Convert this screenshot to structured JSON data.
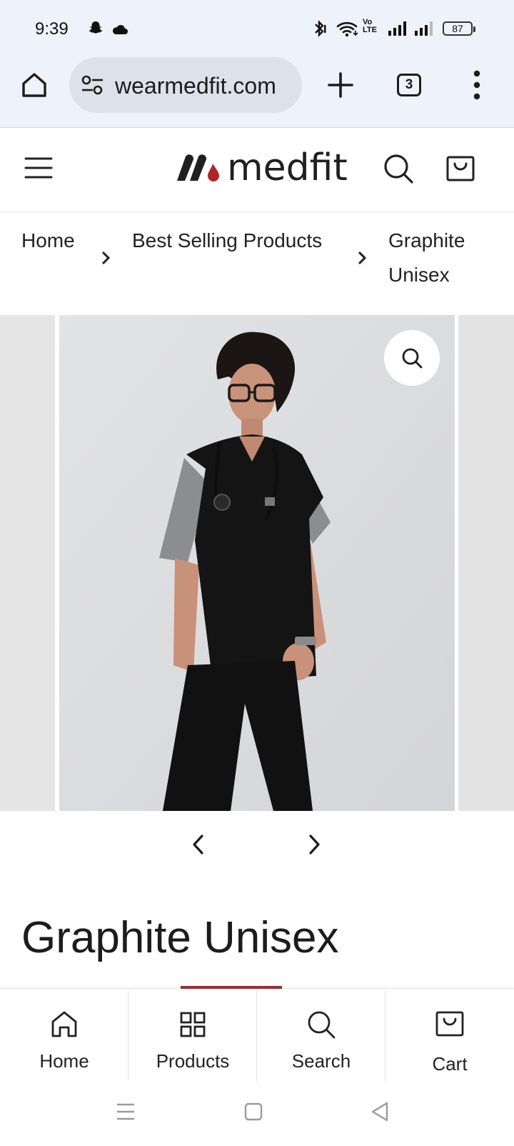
{
  "status_bar": {
    "time": "9:39",
    "volte_top": "Vo",
    "volte_bottom": "LTE",
    "battery": "87"
  },
  "browser": {
    "url": "wearmedfit.com",
    "tab_count": "3"
  },
  "site": {
    "logo_text": "medfit",
    "brand_colors": {
      "dark": "#1f1f1f",
      "accent": "#b0222c"
    }
  },
  "breadcrumb": {
    "items": [
      "Home",
      "Best Selling Products",
      "Graphite",
      "Unisex"
    ]
  },
  "product": {
    "title": "Graphite Unisex"
  },
  "bottom_nav": {
    "items": [
      {
        "label": "Home",
        "icon": "home-icon"
      },
      {
        "label": "Products",
        "icon": "grid-icon"
      },
      {
        "label": "Search",
        "icon": "search-icon"
      },
      {
        "label": "Cart",
        "icon": "cart-icon"
      }
    ],
    "active_indicator_color": "#9b2c33"
  }
}
